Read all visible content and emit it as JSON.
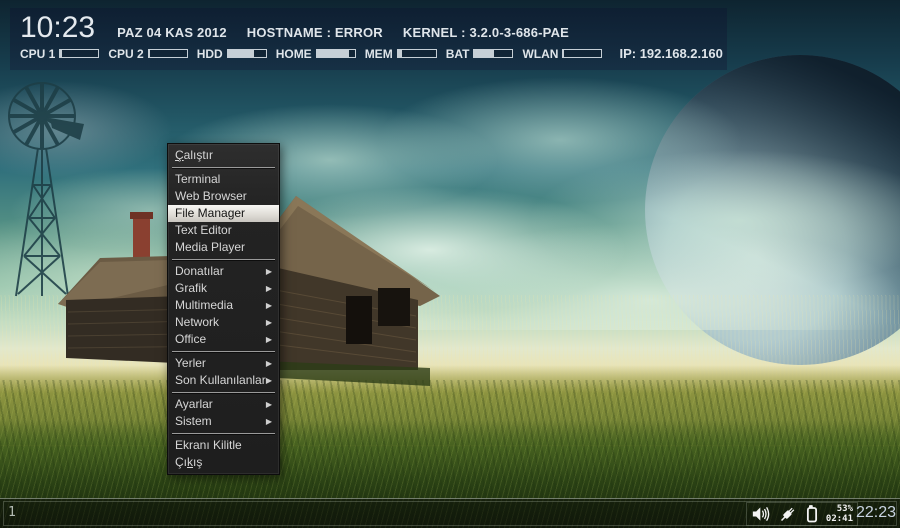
{
  "colors": {
    "panel-text": "#dfe5ea",
    "meter": "#c6cfd6",
    "menu-text": "#d6d6d6",
    "tray-clock": "#c9d4e2"
  },
  "top_panel": {
    "clock": "10:23",
    "date": "PAZ 04 KAS 2012",
    "hostname": "HOSTNAME : ERROR",
    "kernel": "KERNEL : 3.2.0-3-686-PAE",
    "ip": "IP: 192.168.2.160",
    "meters": [
      {
        "label": "CPU 1",
        "percent": 4
      },
      {
        "label": "CPU 2",
        "percent": 4
      },
      {
        "label": "HDD",
        "percent": 70
      },
      {
        "label": "HOME",
        "percent": 86
      },
      {
        "label": "MEM",
        "percent": 12
      },
      {
        "label": "BAT",
        "percent": 52
      },
      {
        "label": "WLAN",
        "percent": 2
      }
    ]
  },
  "menu": {
    "items": [
      {
        "type": "item",
        "label": "Çalıştır",
        "accel": 0
      },
      {
        "type": "separator"
      },
      {
        "type": "item",
        "label": "Terminal"
      },
      {
        "type": "item",
        "label": "Web Browser"
      },
      {
        "type": "item",
        "label": "File Manager",
        "selected": true
      },
      {
        "type": "item",
        "label": "Text Editor"
      },
      {
        "type": "item",
        "label": "Media Player"
      },
      {
        "type": "separator"
      },
      {
        "type": "item",
        "label": "Donatılar",
        "submenu": true
      },
      {
        "type": "item",
        "label": "Grafik",
        "submenu": true
      },
      {
        "type": "item",
        "label": "Multimedia",
        "submenu": true
      },
      {
        "type": "item",
        "label": "Network",
        "submenu": true
      },
      {
        "type": "item",
        "label": "Office",
        "submenu": true
      },
      {
        "type": "separator"
      },
      {
        "type": "item",
        "label": "Yerler",
        "submenu": true
      },
      {
        "type": "item",
        "label": "Son Kullanılanlar",
        "submenu": true
      },
      {
        "type": "separator"
      },
      {
        "type": "item",
        "label": "Ayarlar",
        "submenu": true
      },
      {
        "type": "item",
        "label": "Sistem",
        "submenu": true
      },
      {
        "type": "separator"
      },
      {
        "type": "item",
        "label": "Ekranı Kilitle"
      },
      {
        "type": "item",
        "label": "Çıkış",
        "accel": 2
      }
    ],
    "submenu_arrow": "▶"
  },
  "taskbar": {
    "workspace": "1",
    "battery_percent": "53%",
    "battery_time": "02:41",
    "clock": "22:23"
  }
}
